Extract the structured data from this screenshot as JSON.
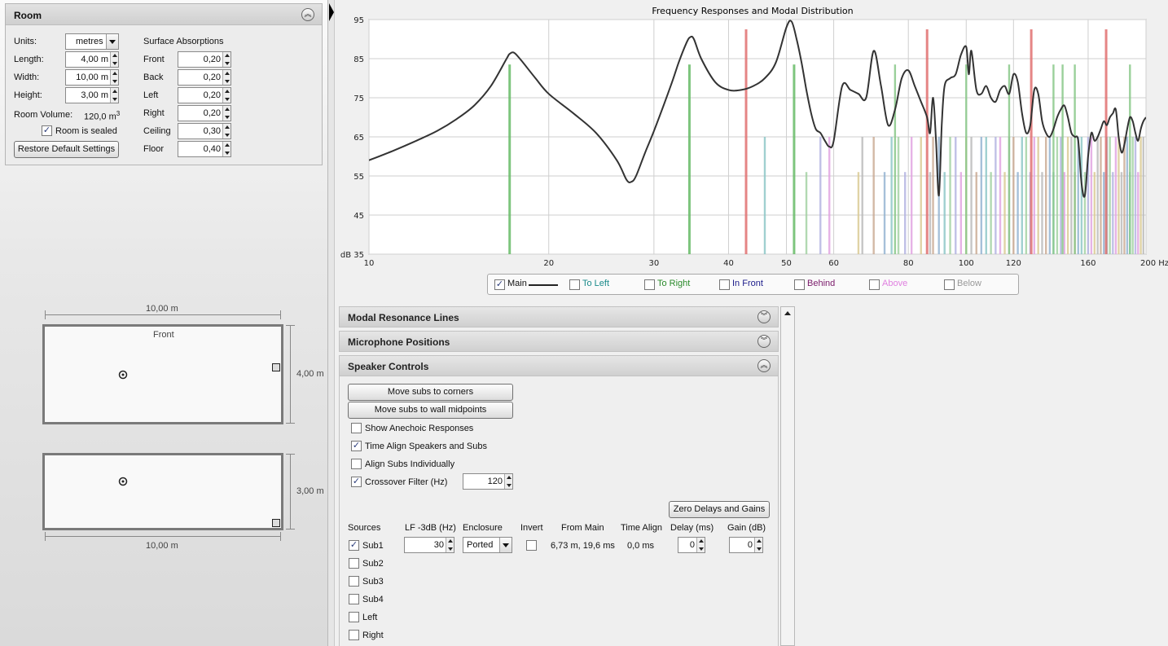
{
  "room_panel": {
    "title": "Room",
    "units_label": "Units:",
    "units_value": "metres",
    "length_label": "Length:",
    "length_value": "4,00 m",
    "width_label": "Width:",
    "width_value": "10,00 m",
    "height_label": "Height:",
    "height_value": "3,00 m",
    "volume_label": "Room Volume:",
    "volume_value": "120,0 m",
    "volume_exp": "3",
    "sealed_label": "Room is sealed",
    "sealed_checked": true,
    "restore_button": "Restore Default Settings",
    "absorptions_title": "Surface Absorptions",
    "absorptions": [
      {
        "label": "Front",
        "value": "0,20"
      },
      {
        "label": "Back",
        "value": "0,20"
      },
      {
        "label": "Left",
        "value": "0,20"
      },
      {
        "label": "Right",
        "value": "0,20"
      },
      {
        "label": "Ceiling",
        "value": "0,30"
      },
      {
        "label": "Floor",
        "value": "0,40"
      }
    ]
  },
  "room_diagram": {
    "top_width_label": "10,00 m",
    "front_label": "Front",
    "top_depth_label": "4,00 m",
    "side_height_label": "3,00 m",
    "bottom_width_label": "10,00 m"
  },
  "legend": {
    "items": [
      {
        "label": "Main",
        "checked": true,
        "color": "#222222"
      },
      {
        "label": "To Left",
        "checked": false,
        "color": "#1a8a8a"
      },
      {
        "label": "To Right",
        "checked": false,
        "color": "#2a8a2a"
      },
      {
        "label": "In Front",
        "checked": false,
        "color": "#1a1a8a"
      },
      {
        "label": "Behind",
        "checked": false,
        "color": "#7a1a6a"
      },
      {
        "label": "Above",
        "checked": false,
        "color": "#e080e0"
      },
      {
        "label": "Below",
        "checked": false,
        "color": "#999999"
      }
    ]
  },
  "sections": {
    "modal_lines": "Modal Resonance Lines",
    "mic_positions": "Microphone Positions",
    "speaker_controls": "Speaker Controls"
  },
  "speaker_controls": {
    "move_corners": "Move subs to corners",
    "move_midpoints": "Move subs to wall midpoints",
    "show_anechoic": {
      "label": "Show Anechoic Responses",
      "checked": false
    },
    "time_align": {
      "label": "Time Align Speakers and Subs",
      "checked": true
    },
    "align_individually": {
      "label": "Align Subs Individually",
      "checked": false
    },
    "crossover": {
      "label": "Crossover Filter (Hz)",
      "checked": true,
      "value": "120"
    },
    "zero_button": "Zero Delays and Gains",
    "columns": [
      "Sources",
      "LF -3dB (Hz)",
      "Enclosure",
      "Invert",
      "From Main",
      "Time Align",
      "Delay (ms)",
      "Gain (dB)"
    ],
    "sub1": {
      "label": "Sub1",
      "checked": true,
      "lf": "30",
      "enclosure": "Ported",
      "invert": false,
      "from_main": "6,73 m, 19,6 ms",
      "time_align": "0,0 ms",
      "delay": "0",
      "gain": "0"
    },
    "sources": [
      {
        "label": "Sub2",
        "checked": false
      },
      {
        "label": "Sub3",
        "checked": false
      },
      {
        "label": "Sub4",
        "checked": false
      },
      {
        "label": "Left",
        "checked": false
      },
      {
        "label": "Right",
        "checked": false
      }
    ]
  },
  "chart_data": {
    "type": "line",
    "title": "Frequency Responses and Modal Distribution",
    "xscale": "log",
    "xlim": [
      10,
      200
    ],
    "ylim": [
      35,
      95
    ],
    "xticks": [
      10,
      20,
      30,
      40,
      50,
      60,
      80,
      100,
      120,
      160,
      200
    ],
    "xtick_labels": [
      "10",
      "20",
      "30",
      "40",
      "50",
      "60",
      "80",
      "100",
      "120",
      "160",
      "200 Hz"
    ],
    "yticks": [
      35,
      45,
      55,
      65,
      75,
      85,
      95
    ],
    "ytick_labels": [
      "dB 35",
      "45",
      "55",
      "65",
      "75",
      "85",
      "95"
    ],
    "grid": true,
    "series": [
      {
        "name": "Main",
        "color": "#333333",
        "x": [
          10,
          11,
          12,
          13,
          14,
          15,
          16,
          17,
          17.2,
          17.5,
          18,
          19,
          20,
          22,
          24,
          26,
          27,
          27.5,
          28,
          29,
          30,
          32,
          33,
          34,
          34.5,
          35,
          36,
          38,
          40,
          42,
          44,
          46,
          48,
          50,
          51,
          52,
          53,
          54,
          55,
          56,
          57,
          58,
          59,
          60,
          62,
          64,
          66,
          68,
          70,
          72,
          74,
          76,
          78,
          80,
          82,
          84,
          86,
          87,
          88,
          89,
          90,
          91,
          92,
          94,
          96,
          98,
          100,
          101,
          102,
          104,
          106,
          108,
          110,
          112,
          114,
          116,
          118,
          120,
          122,
          124,
          126,
          128,
          130,
          132,
          134,
          136,
          138,
          140,
          142,
          144,
          146,
          148,
          150,
          152,
          154,
          156,
          158,
          160,
          162,
          164,
          166,
          168,
          170,
          172,
          174,
          176,
          178,
          180,
          182,
          184,
          186,
          188,
          190,
          192,
          194,
          196,
          198,
          200
        ],
        "y": [
          59,
          61.5,
          64,
          66.5,
          69.5,
          73,
          78,
          85,
          86.2,
          86.5,
          84.5,
          80,
          76,
          71,
          66,
          59,
          54,
          53.5,
          55,
          61,
          66.5,
          78,
          84,
          89,
          90.5,
          90,
          85,
          79,
          77,
          77,
          78,
          80,
          84,
          93,
          94.5,
          90,
          84,
          77,
          71,
          67,
          66,
          64,
          62.5,
          64,
          78,
          77,
          76,
          75,
          87,
          78,
          68,
          72,
          80,
          82,
          78,
          74,
          70,
          66,
          75,
          64,
          50,
          68,
          78,
          80,
          81,
          86,
          88,
          81,
          87,
          77,
          76,
          78,
          75,
          74,
          77,
          78,
          76,
          81,
          79,
          71,
          66,
          68,
          77,
          76,
          69,
          66,
          65,
          67,
          70,
          72,
          73,
          70,
          66,
          65,
          64,
          53,
          50,
          60,
          66,
          64,
          65,
          67,
          69,
          68,
          70,
          71,
          72,
          65,
          61,
          63,
          67,
          70,
          69,
          66,
          64,
          67,
          69,
          70
        ]
      }
    ],
    "modal_lines": {
      "note": "",
      "tall": [
        {
          "f": 17.2,
          "h": 83.5,
          "color": "#66bb66"
        },
        {
          "f": 34.4,
          "h": 83.5,
          "color": "#66bb66"
        },
        {
          "f": 42.8,
          "h": 92.5,
          "color": "#e07070"
        },
        {
          "f": 51.5,
          "h": 83.5,
          "color": "#66bb66"
        },
        {
          "f": 86.0,
          "h": 92.5,
          "color": "#e07070"
        },
        {
          "f": 128.5,
          "h": 92.5,
          "color": "#e07070"
        },
        {
          "f": 171.5,
          "h": 92.5,
          "color": "#e07070"
        }
      ]
    }
  }
}
